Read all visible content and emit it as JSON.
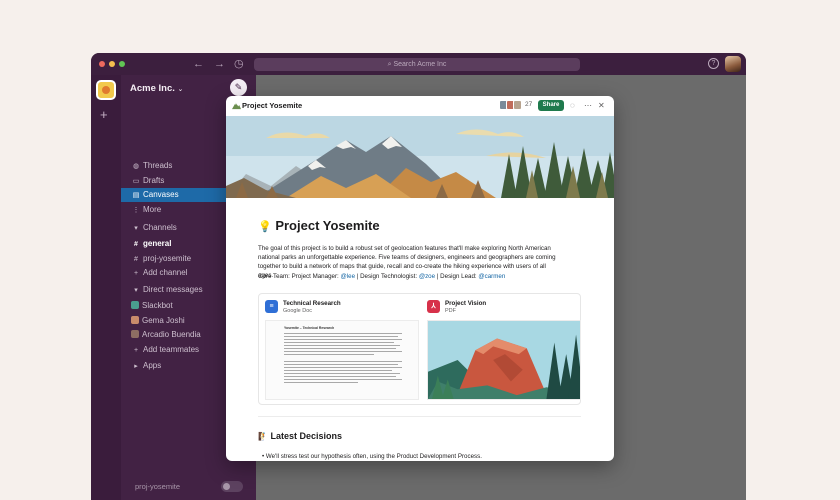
{
  "colors": {
    "sidebar_bg": "#422244",
    "titlebar_bg": "#3c1f3e",
    "active_item": "#1e6aa8",
    "share_button": "#1f7a4d",
    "mention": "#1264a3"
  },
  "titlebar": {
    "search_placeholder": "Search Acme Inc",
    "back_icon": "arrow-left",
    "forward_icon": "arrow-right",
    "history_icon": "clock",
    "help_icon": "question-circle"
  },
  "sidebar": {
    "workspace_name": "Acme Inc.",
    "workspace_chevron": "⌄",
    "items": [
      {
        "icon": "threads-icon",
        "label": "Threads"
      },
      {
        "icon": "drafts-icon",
        "label": "Drafts"
      },
      {
        "icon": "canvases-icon",
        "label": "Canvases"
      },
      {
        "icon": "more-icon",
        "label": "More"
      }
    ],
    "channels_header": "Channels",
    "channels": [
      {
        "label": "general"
      },
      {
        "label": "proj-yosemite"
      },
      {
        "label": "Add channel"
      }
    ],
    "dm_header": "Direct messages",
    "dms": [
      {
        "label": "Slackbot"
      },
      {
        "label": "Gema Joshi"
      },
      {
        "label": "Arcadio Buendia"
      },
      {
        "label": "Add teammates"
      }
    ],
    "apps_header": "Apps",
    "footer_label": "proj-yosemite"
  },
  "canvas": {
    "title": "Project Yosemite",
    "member_count": "27",
    "share_label": "Share",
    "doc_emoji": "💡",
    "doc_title": "Project Yosemite",
    "body": "The goal of this project is to build a robust set of geolocation features that'll make exploring North American national parks an unforgettable experience. Five teams of designers, engineers and geographers are coming together to build a network of maps that guide, recall and co-create the hiking experience with users of all ages.",
    "core_team": {
      "prefix": "Core Team:",
      "pm_label": "Project Manager:",
      "pm": "@lee",
      "sep1": "|",
      "dt_label": "Design Technologist:",
      "dt": "@zoe",
      "sep2": "|",
      "dl_label": "Design Lead:",
      "dl": "@carmen"
    },
    "cards": [
      {
        "title": "Technical Research",
        "subtitle": "Google Doc",
        "icon_glyph": "≡",
        "preview_title": "Yosemite – Technical Research"
      },
      {
        "title": "Project Vision",
        "subtitle": "PDF",
        "icon_glyph": "⅄"
      }
    ],
    "decisions_emoji": "🧗",
    "decisions_title": "Latest Decisions",
    "bullets": [
      "We'll stress test our hypothesis often, using the  Product Development Process."
    ]
  }
}
